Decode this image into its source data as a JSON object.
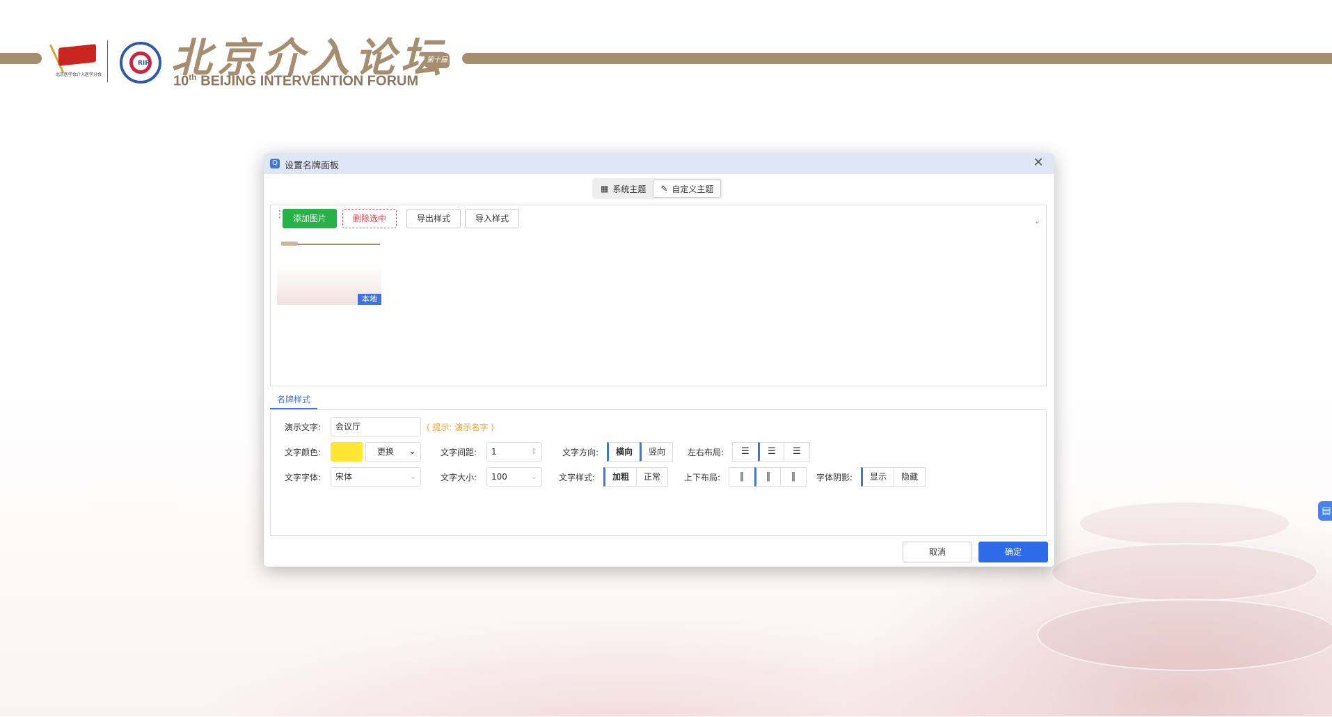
{
  "header": {
    "calligraphy": "北京介入论坛",
    "seal_text": "第十届",
    "forum_ordinal": "10",
    "forum_ordinal_sup": "th",
    "forum_name": "BEIJING INTERVENTION FORUM",
    "assoc_caption": "北京医学会介入医学分会",
    "rif_text": "RIF"
  },
  "dialog": {
    "title": "设置名牌面板",
    "title_icon": "Q",
    "close_icon": "✕",
    "theme_tabs": [
      {
        "label": "系统主题",
        "icon": "monitor-icon"
      },
      {
        "label": "自定义主题",
        "icon": "pencil-icon"
      }
    ],
    "toolbar": {
      "add_image": "添加图片",
      "delete_selected": "删除选中",
      "export_style": "导出样式",
      "import_style": "导入样式"
    },
    "thumbnail": {
      "badge": "本地"
    },
    "style_tab": "名牌样式",
    "form": {
      "demo_text_label": "演示文字:",
      "demo_text_value": "会议厅",
      "demo_text_hint": "( 提示: 演示名字 )",
      "text_color_label": "文字颜色:",
      "text_color_value": "#ffe634",
      "change_label": "更换",
      "letter_spacing_label": "文字间距:",
      "letter_spacing_value": "1",
      "text_direction_label": "文字方向:",
      "direction_options": [
        "横向",
        "竖向"
      ],
      "h_layout_label": "左右布局:",
      "font_label": "文字字体:",
      "font_value": "宋体",
      "font_size_label": "文字大小:",
      "font_size_value": "100",
      "font_style_label": "文字样式:",
      "style_options": [
        "加粗",
        "正常"
      ],
      "v_layout_label": "上下布局:",
      "shadow_label": "字体阴影:",
      "shadow_options": [
        "显示",
        "隐藏"
      ]
    },
    "footer": {
      "cancel": "取消",
      "ok": "确定"
    }
  },
  "colors": {
    "accent": "#3f74d8",
    "add_green": "#27b148",
    "delete_red": "#e0494f",
    "brand_band": "#a58d70"
  }
}
